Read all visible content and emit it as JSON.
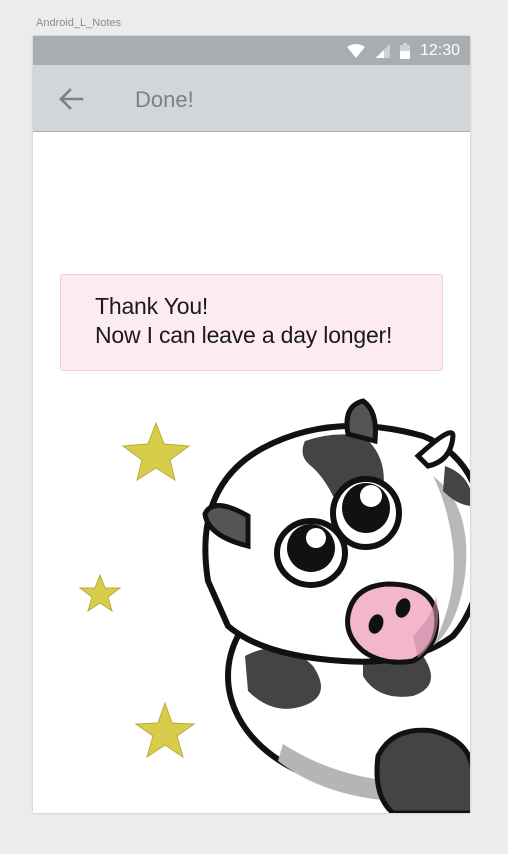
{
  "canvas": {
    "label": "Android_L_Notes"
  },
  "status_bar": {
    "time": "12:30",
    "icons": [
      "wifi-icon",
      "cell-signal-icon",
      "battery-icon"
    ]
  },
  "app_bar": {
    "back_icon": "arrow-left-icon",
    "title": "Done!"
  },
  "message": {
    "line1": "Thank You!",
    "line2": "Now I can leave a day longer!"
  },
  "illustration": {
    "stars": 3,
    "character": "cow"
  },
  "colors": {
    "status_bar": "#a7adb1",
    "app_bar": "#d0d6da",
    "card_bg": "#fdebf4",
    "star": "#d8cd4a"
  }
}
